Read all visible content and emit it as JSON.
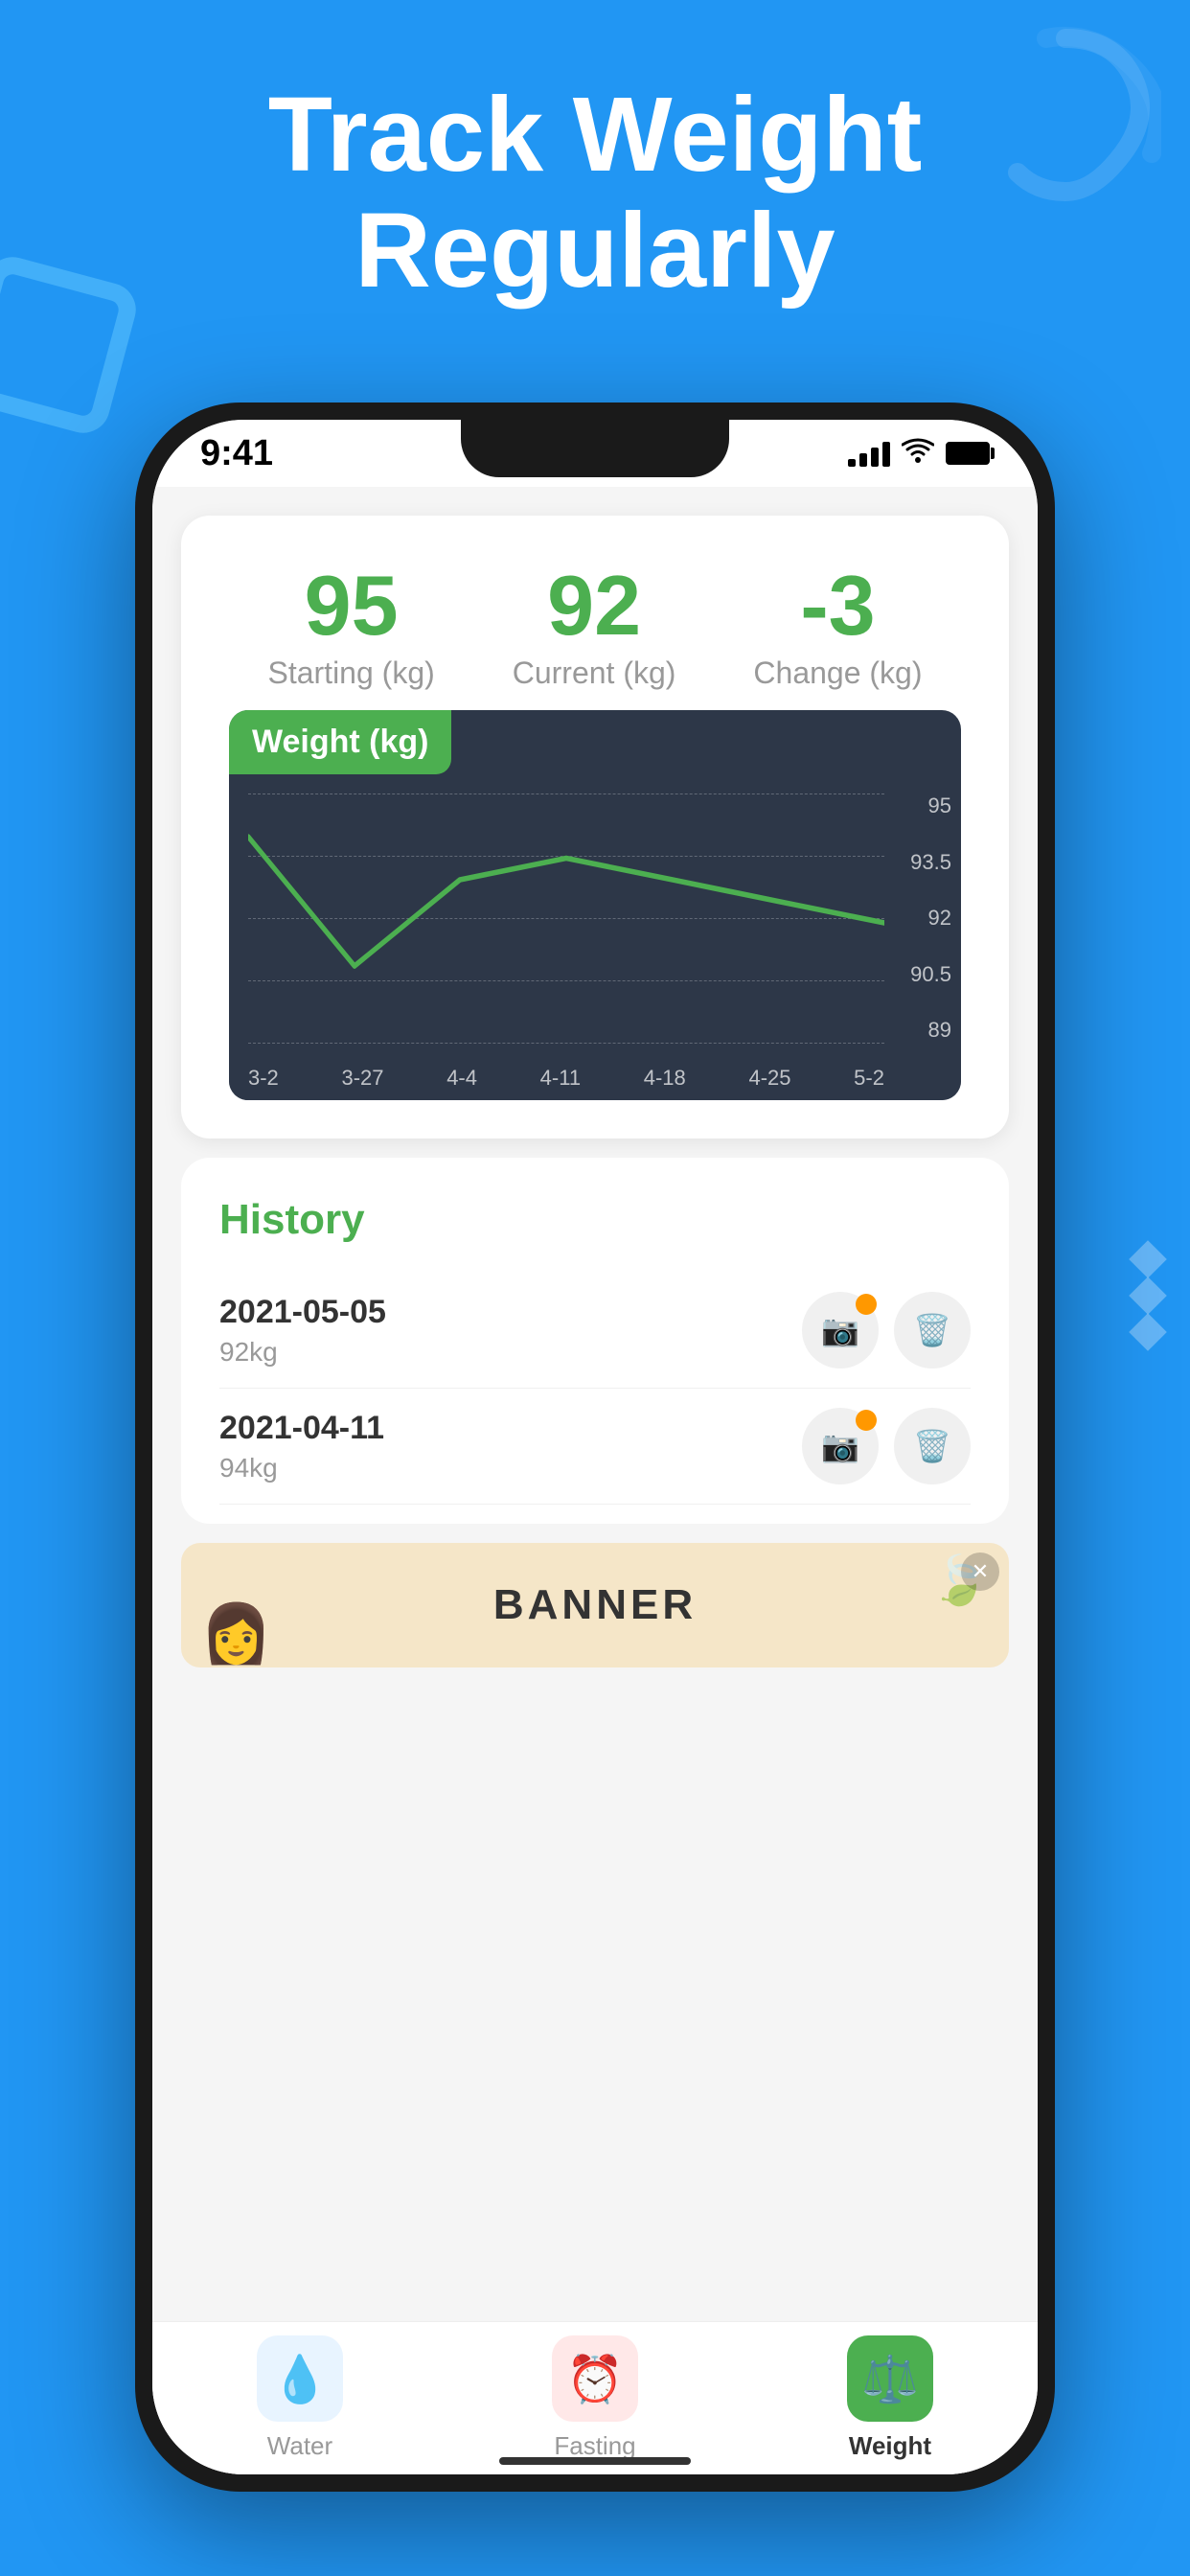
{
  "header": {
    "title_line1": "Track Weight",
    "title_line2": "Regularly"
  },
  "status_bar": {
    "time": "9:41"
  },
  "stats": {
    "starting_value": "95",
    "starting_label": "Starting (kg)",
    "current_value": "92",
    "current_label": "Current (kg)",
    "change_value": "-3",
    "change_label": "Change (kg)"
  },
  "chart": {
    "title": "Weight  (kg)",
    "y_labels": [
      "95",
      "93.5",
      "92",
      "90.5",
      "89"
    ],
    "x_labels": [
      "3-2",
      "3-27",
      "4-4",
      "4-11",
      "4-18",
      "4-25",
      "5-2"
    ]
  },
  "history": {
    "title": "History",
    "items": [
      {
        "date": "2021-05-05",
        "weight": "92kg"
      },
      {
        "date": "2021-04-11",
        "weight": "94kg"
      }
    ]
  },
  "banner": {
    "text": "BANNER"
  },
  "bottom_nav": {
    "items": [
      {
        "label": "Water",
        "icon": "💧",
        "type": "water",
        "active": false
      },
      {
        "label": "Fasting",
        "icon": "⏰",
        "type": "fasting",
        "active": false
      },
      {
        "label": "Weight",
        "icon": "⚖️",
        "type": "weight",
        "active": true
      }
    ]
  }
}
